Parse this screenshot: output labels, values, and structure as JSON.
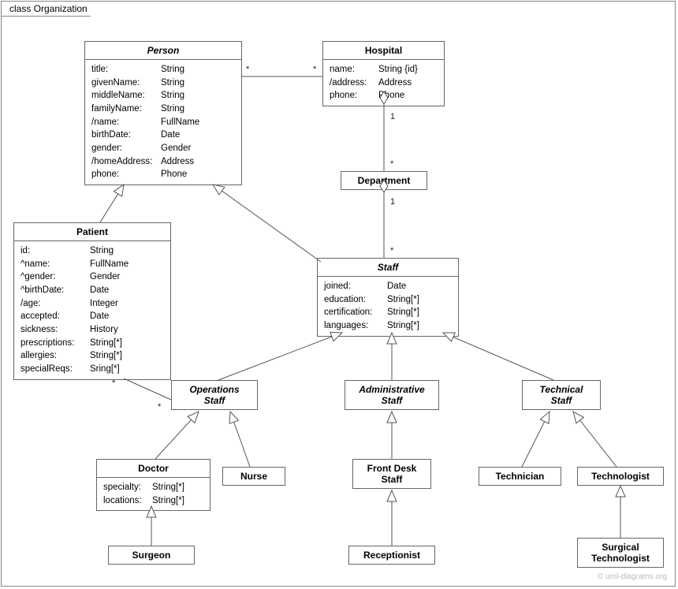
{
  "frame": {
    "label": "class Organization"
  },
  "classes": {
    "person": {
      "name": "Person",
      "attrs": [
        {
          "name": "title:",
          "type": "String"
        },
        {
          "name": "givenName:",
          "type": "String"
        },
        {
          "name": "middleName:",
          "type": "String"
        },
        {
          "name": "familyName:",
          "type": "String"
        },
        {
          "name": "/name:",
          "type": "FullName"
        },
        {
          "name": "birthDate:",
          "type": "Date"
        },
        {
          "name": "gender:",
          "type": "Gender"
        },
        {
          "name": "/homeAddress:",
          "type": "Address"
        },
        {
          "name": "phone:",
          "type": "Phone"
        }
      ]
    },
    "hospital": {
      "name": "Hospital",
      "attrs": [
        {
          "name": "name:",
          "type": "String {id}"
        },
        {
          "name": "/address:",
          "type": "Address"
        },
        {
          "name": "phone:",
          "type": "Phone"
        }
      ]
    },
    "department": {
      "name": "Department",
      "attrs": []
    },
    "patient": {
      "name": "Patient",
      "attrs": [
        {
          "name": "id:",
          "type": "String"
        },
        {
          "name": "^name:",
          "type": "FullName"
        },
        {
          "name": "^gender:",
          "type": "Gender"
        },
        {
          "name": "^birthDate:",
          "type": "Date"
        },
        {
          "name": "/age:",
          "type": "Integer"
        },
        {
          "name": "accepted:",
          "type": "Date"
        },
        {
          "name": "sickness:",
          "type": "History"
        },
        {
          "name": "prescriptions:",
          "type": "String[*]"
        },
        {
          "name": "allergies:",
          "type": "String[*]"
        },
        {
          "name": "specialReqs:",
          "type": "Sring[*]"
        }
      ]
    },
    "staff": {
      "name": "Staff",
      "attrs": [
        {
          "name": "joined:",
          "type": "Date"
        },
        {
          "name": "education:",
          "type": "String[*]"
        },
        {
          "name": "certification:",
          "type": "String[*]"
        },
        {
          "name": "languages:",
          "type": "String[*]"
        }
      ]
    },
    "opsStaff": {
      "name": "Operations\nStaff",
      "attrs": []
    },
    "adminStaff": {
      "name": "Administrative\nStaff",
      "attrs": []
    },
    "techStaff": {
      "name": "Technical\nStaff",
      "attrs": []
    },
    "doctor": {
      "name": "Doctor",
      "attrs": [
        {
          "name": "specialty:",
          "type": "String[*]"
        },
        {
          "name": "locations:",
          "type": "String[*]"
        }
      ]
    },
    "nurse": {
      "name": "Nurse",
      "attrs": []
    },
    "frontDesk": {
      "name": "Front Desk\nStaff",
      "attrs": []
    },
    "technician": {
      "name": "Technician",
      "attrs": []
    },
    "technologist": {
      "name": "Technologist",
      "attrs": []
    },
    "surgeon": {
      "name": "Surgeon",
      "attrs": []
    },
    "receptionist": {
      "name": "Receptionist",
      "attrs": []
    },
    "surgTech": {
      "name": "Surgical\nTechnologist",
      "attrs": []
    }
  },
  "multiplicities": {
    "m1": "*",
    "m2": "*",
    "m3": "1",
    "m4": "*",
    "m5": "1",
    "m6": "*",
    "m7": "*",
    "m8": "*"
  },
  "watermark": "© uml-diagrams.org"
}
